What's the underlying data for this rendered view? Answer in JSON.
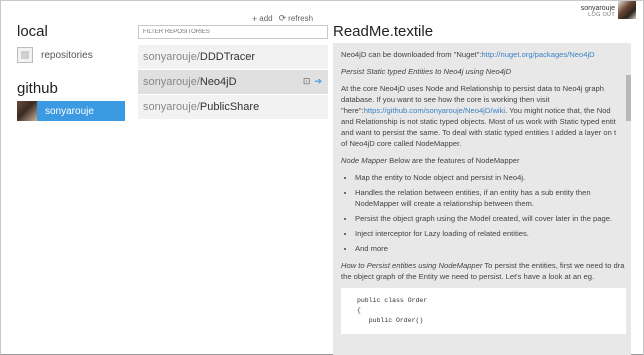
{
  "sidebar": {
    "local_title": "local",
    "repositories_label": "repositories",
    "github_title": "github",
    "account_name": "sonyarouje"
  },
  "toolbar": {
    "add_glyph": "+",
    "add_label": "add",
    "refresh_glyph": "⟳",
    "refresh_label": "refresh"
  },
  "filter": {
    "placeholder": "FILTER REPOSITORIES"
  },
  "repos": [
    {
      "owner": "sonyarouje/",
      "name": "DDDTracer"
    },
    {
      "owner": "sonyarouje/",
      "name": "Neo4jD"
    },
    {
      "owner": "sonyarouje/",
      "name": "PublicShare"
    }
  ],
  "repo_actions": {
    "clone_glyph": "⊡",
    "go_glyph": "➔"
  },
  "user": {
    "name": "sonyarouje",
    "logout": "LOG OUT"
  },
  "readme": {
    "title": "ReadMe.textile",
    "p1_text": "Neo4jD can be downloaded from \"Nuget\":",
    "p1_link": "http://nuget.org/packages/Neo4jD",
    "p2": "Persist Static typed Entities to Neo4j using Neo4jD",
    "p3_l1": "At the core Neo4jD uses Node and Relationship to persist data to Neo4j graph",
    "p3_l2": "database. If you want to see how the core is working then visit",
    "p3_l3_a": "\"here\":",
    "p3_l3_link": "https://github.com/sonyarouje/Neo4jD/wiki",
    "p3_l3_b": ". You might notice that, the Nod",
    "p3_l4": "and Relationship is not static typed objects. Most of us work with Static typed entit",
    "p3_l5": "and want to persist the same. To deal with static typed entities I added a layer on t",
    "p3_l6": "of Neo4jD core called NodeMapper.",
    "p4_em": "Node Mapper",
    "p4_rest": " Below are the features of NodeMapper",
    "features": [
      "Map the entity to Node object and persist in Neo4j.",
      "Handles the relation between entities, if an entity has a sub entity then",
      "Persist the object graph using the Model created, will cover later in the page.",
      "Inject interceptor for Lazy loading of related entities.",
      "And more"
    ],
    "feature2_cont": "NodeMapper will create a relationship between them.",
    "p5_em": "How to Persist entities using NodeMapper",
    "p5_rest": " To persist the entities, first we need to dra",
    "p5_l2": "the object graph of the Entity we need to persist. Let's have a look at an eg.",
    "code": [
      "public class Order",
      "{",
      "   public Order()"
    ]
  }
}
